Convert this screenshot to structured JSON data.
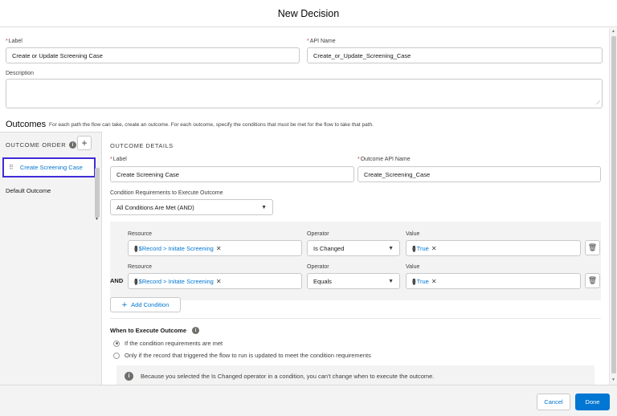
{
  "modal": {
    "title": "New Decision"
  },
  "label_field": {
    "label": "Label",
    "value": "Create or Update Screening Case"
  },
  "api_name_field": {
    "label": "API Name",
    "value": "Create_or_Update_Screening_Case"
  },
  "description_field": {
    "label": "Description",
    "value": ""
  },
  "outcomes": {
    "title": "Outcomes",
    "description": "For each path the flow can take, create an outcome. For each outcome, specify the conditions that must be met for the flow to take that path.",
    "order_label": "OUTCOME ORDER",
    "items": [
      {
        "label": "Create Screening Case",
        "selected": true
      },
      {
        "label": "Default Outcome",
        "selected": false
      }
    ]
  },
  "details": {
    "section_title": "OUTCOME DETAILS",
    "label_label": "Label",
    "label_value": "Create Screening Case",
    "api_label": "Outcome API Name",
    "api_value": "Create_Screening_Case",
    "cond_req_label": "Condition Requirements to Execute Outcome",
    "cond_req_value": "All Conditions Are Met (AND)"
  },
  "conditions": {
    "resource_label": "Resource",
    "operator_label": "Operator",
    "value_label": "Value",
    "connector": "AND",
    "rows": [
      {
        "resource": "$Record > Initate Screening",
        "operator": "Is Changed",
        "value": "True"
      },
      {
        "resource": "$Record > Initate Screening",
        "operator": "Equals",
        "value": "True"
      }
    ],
    "add_label": "Add Condition"
  },
  "when": {
    "title": "When to Execute Outcome",
    "options": [
      {
        "label": "If the condition requirements are met",
        "checked": true
      },
      {
        "label": "Only if the record that triggered the flow to run is updated to meet the condition requirements",
        "checked": false
      }
    ],
    "notice": "Because you selected the Is Changed operator in a condition, you can't change when to execute the outcome."
  },
  "footer": {
    "cancel_label": "Cancel",
    "done_label": "Done"
  },
  "colors": {
    "brand": "#0176d3",
    "focus_border": "#3f2cd7"
  }
}
